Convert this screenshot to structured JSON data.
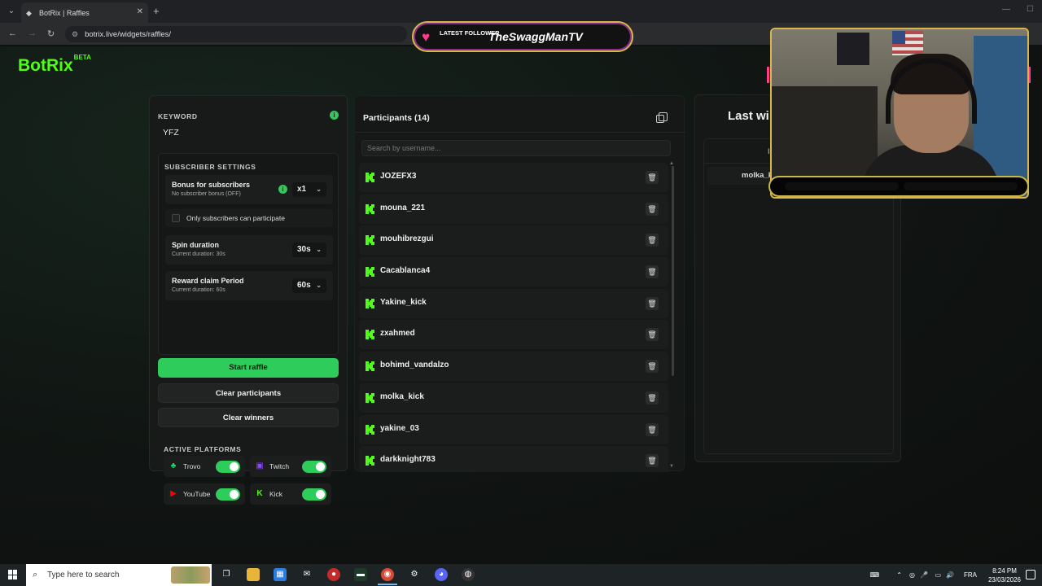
{
  "browser": {
    "tab_title": "BotRix | Raffles",
    "tab_close": "✕",
    "new_tab": "+",
    "url": "botrix.live/widgets/raffles/",
    "back": "←",
    "forward": "→",
    "reload": "↻"
  },
  "app": {
    "logo": "BotRix",
    "logo_badge": "BETA"
  },
  "left": {
    "keyword_label": "KEYWORD",
    "keyword_value": "YFZ",
    "subscriber_settings_label": "SUBSCRIBER SETTINGS",
    "bonus_title": "Bonus for subscribers",
    "bonus_sub": "No subscriber bonus (OFF)",
    "bonus_value": "x1",
    "only_subs_label": "Only subscribers can participate",
    "spin_title": "Spin duration",
    "spin_sub": "Current duration: 30s",
    "spin_value": "30s",
    "reward_title": "Reward claim Period",
    "reward_sub": "Current duration: 60s",
    "reward_value": "60s",
    "start_raffle": "Start raffle",
    "clear_participants": "Clear participants",
    "clear_winners": "Clear winners",
    "active_platforms_label": "ACTIVE PLATFORMS",
    "platforms": [
      {
        "name": "Trovo",
        "icon": "trovo-icon",
        "color": "#1bdb7a",
        "enabled": true
      },
      {
        "name": "Twitch",
        "icon": "twitch-icon",
        "color": "#9146ff",
        "enabled": true
      },
      {
        "name": "YouTube",
        "icon": "youtube-icon",
        "color": "#ff0000",
        "enabled": true
      },
      {
        "name": "Kick",
        "icon": "kick-icon",
        "color": "#53fc18",
        "enabled": true
      }
    ]
  },
  "participants": {
    "title": "Participants (14)",
    "search_placeholder": "Search by username...",
    "list": [
      "JOZEFX3",
      "mouna_221",
      "mouhibrezgui",
      "Cacablanca4",
      "Yakine_kick",
      "zxahmed",
      "bohimd_vandalzo",
      "molka_kick",
      "yakine_03",
      "darkknight783"
    ]
  },
  "winners": {
    "title": "Last wi",
    "header_partial": "I",
    "rows": [
      "molka_ki"
    ]
  },
  "overlay": {
    "follower_label": "LATEST FOLLOWER",
    "follower_name": "TheSwaggManTV"
  },
  "taskbar": {
    "search_placeholder": "Type here to search",
    "lang": "FRA",
    "time": "8:24 PM",
    "date": "23/03/2026"
  },
  "colors": {
    "accent": "#2ecc5b",
    "kick_green": "#53fc18"
  }
}
